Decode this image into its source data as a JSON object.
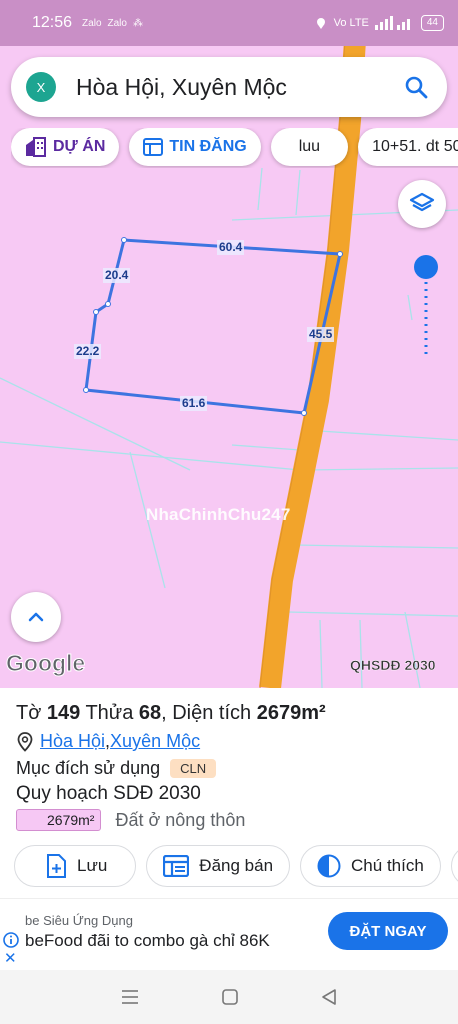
{
  "status": {
    "time": "12:56",
    "mini_icons": [
      "Zalo",
      "Zalo",
      "⁂"
    ],
    "network": "Vo LTE",
    "battery": "44"
  },
  "search": {
    "close_label": "X",
    "query": "Hòa Hội, Xuyên Mộc"
  },
  "chips": [
    {
      "label": "DỰ ÁN"
    },
    {
      "label": "TIN ĐĂNG"
    },
    {
      "label": "luu"
    },
    {
      "label": "10+51.  dt 50"
    }
  ],
  "map": {
    "measurements": [
      "60.4",
      "20.4",
      "22.2",
      "45.5",
      "61.6"
    ],
    "watermark": "NhaChinhChu247",
    "google_logo": "Google",
    "plan_label": "QHSDĐ 2030",
    "colors": {
      "zone": "#f7c9f4",
      "road": "#f2a42b",
      "parcel": "#3d74e0"
    }
  },
  "sheet": {
    "title_prefix": "Tờ ",
    "sheet_no": "149",
    "title_mid": " Thửa ",
    "parcel_no": "68",
    "title_area_label": ", Diện tích ",
    "area": "2679m²",
    "loc_ward": "Hòa Hội",
    "loc_sep": ", ",
    "loc_district": "Xuyên Mộc",
    "purpose_label": "Mục đích sử dụng",
    "purpose_code": "CLN",
    "plan_title": "Quy hoạch SDĐ 2030",
    "plan_area": "2679m²",
    "plan_desc": "Đất ở nông thôn"
  },
  "actions": [
    {
      "label": "Lưu"
    },
    {
      "label": "Đăng bán"
    },
    {
      "label": "Chú thích"
    }
  ],
  "ad": {
    "sponsor": "be Siêu Ứng Dụng",
    "headline": "beFood đãi to combo gà chỉ 86K",
    "cta": "ĐẶT NGAY",
    "close": "✕"
  }
}
